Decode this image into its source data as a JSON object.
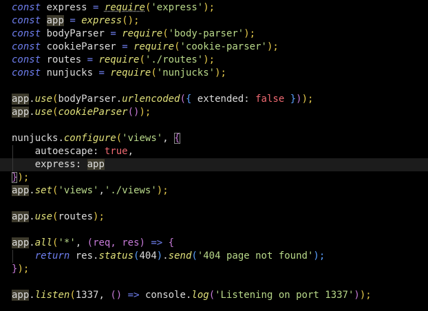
{
  "colors": {
    "background": "#000000",
    "keyword": "#6f7ff0",
    "function": "#e0e07a",
    "string": "#b9d98a",
    "boolean": "#f06a72",
    "text": "#dcdcdc",
    "bracket_yellow": "#e8cc4c",
    "bracket_purple": "#c77ad8",
    "bracket_blue": "#5aa0ff",
    "highlight": "#3d3a2c"
  },
  "code": {
    "l1": {
      "kw": "const",
      "name": "express",
      "eq": "=",
      "fn": "require",
      "open": "(",
      "arg": "'express'",
      "close": ");"
    },
    "l2": {
      "kw": "const",
      "name": "app",
      "eq": "=",
      "fn": "express",
      "call": "();"
    },
    "l3": {
      "kw": "const",
      "name": "bodyParser",
      "eq": "=",
      "fn": "require",
      "open": "(",
      "arg": "'body-parser'",
      "close": ");"
    },
    "l4": {
      "kw": "const",
      "name": "cookieParser",
      "eq": "=",
      "fn": "require",
      "open": "(",
      "arg": "'cookie-parser'",
      "close": ");"
    },
    "l5": {
      "kw": "const",
      "name": "routes",
      "eq": "=",
      "fn": "require",
      "open": "(",
      "arg": "'./routes'",
      "close": ");"
    },
    "l6": {
      "kw": "const",
      "name": "nunjucks",
      "eq": "=",
      "fn": "require",
      "open": "(",
      "arg": "'nunjucks'",
      "close": ");"
    },
    "l7": {
      "app": "app",
      "dot": ".",
      "fn": "use",
      "open": "(",
      "obj": "bodyParser",
      "dot2": ".",
      "fn2": "urlencoded",
      "open2": "(",
      "brace": "{",
      "key": " extended:",
      "val": "false",
      "brace_close": "}",
      "close2": ")",
      "close": ");"
    },
    "l8": {
      "app": "app",
      "dot": ".",
      "fn": "use",
      "open": "(",
      "fn2": "cookieParser",
      "call": "()",
      "close": ");"
    },
    "l9": {
      "obj": "nunjucks",
      "dot": ".",
      "fn": "configure",
      "open": "(",
      "arg": "'views'",
      "comma": ",",
      "brace": "{"
    },
    "l10": {
      "key": "autoescape:",
      "val": "true",
      "comma": ","
    },
    "l11": {
      "key": "express:",
      "val": "app"
    },
    "l12": {
      "brace": "}",
      "close": ");"
    },
    "l13": {
      "app": "app",
      "dot": ".",
      "fn": "set",
      "open": "(",
      "arg1": "'views'",
      "comma": ",",
      "arg2": "'./views'",
      "close": ");"
    },
    "l14": {
      "app": "app",
      "dot": ".",
      "fn": "use",
      "open": "(",
      "arg": "routes",
      "close": ");"
    },
    "l15": {
      "app": "app",
      "dot": ".",
      "fn": "all",
      "open": "(",
      "arg": "'*'",
      "comma": ",",
      "params": "(req, res)",
      "arrow": "=>",
      "brace": "{"
    },
    "l16": {
      "kw": "return",
      "obj": "res",
      "dot": ".",
      "fn": "status",
      "open": "(",
      "num": "404",
      "close": ")",
      "dot2": ".",
      "fn2": "send",
      "open2": "(",
      "arg": "'404 page not found'",
      "close2": ");"
    },
    "l17": {
      "brace": "}",
      "close": ");"
    },
    "l18": {
      "app": "app",
      "dot": ".",
      "fn": "listen",
      "open": "(",
      "num": "1337",
      "comma": ",",
      "params": "()",
      "arrow": "=>",
      "obj": "console",
      "dot2": ".",
      "fn2": "log",
      "open2": "(",
      "arg": "'Listening on port 1337'",
      "close2": ")",
      "close": ");"
    }
  }
}
